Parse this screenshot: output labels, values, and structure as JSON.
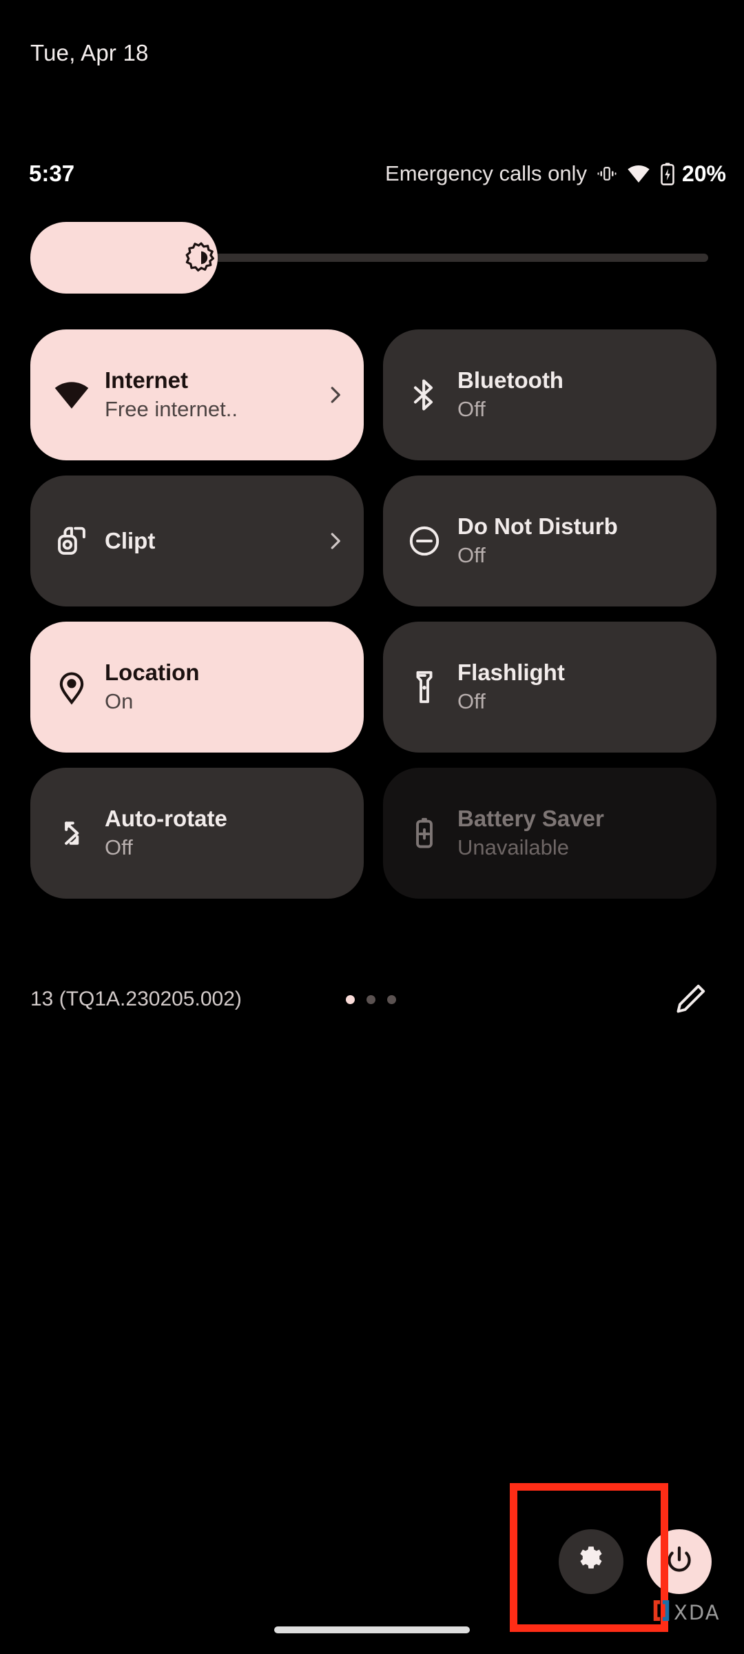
{
  "header": {
    "date": "Tue, Apr 18"
  },
  "status_bar": {
    "clock": "5:37",
    "carrier": "Emergency calls only",
    "battery_percent": "20%",
    "icons": [
      "vibrate-icon",
      "wifi-icon",
      "battery-charging-icon"
    ]
  },
  "brightness": {
    "name": "brightness-slider",
    "icon": "brightness-icon",
    "level_percent": 27
  },
  "tiles": [
    {
      "label": "Internet",
      "sub": "Free internet..",
      "state": "active",
      "icon": "wifi-icon",
      "chevron": true
    },
    {
      "label": "Bluetooth",
      "sub": "Off",
      "state": "inactive",
      "icon": "bluetooth-icon",
      "chevron": false
    },
    {
      "label": "Clipt",
      "sub": "",
      "state": "inactive",
      "icon": "clipt-icon",
      "chevron": true
    },
    {
      "label": "Do Not Disturb",
      "sub": "Off",
      "state": "inactive",
      "icon": "do-not-disturb-icon",
      "chevron": false
    },
    {
      "label": "Location",
      "sub": "On",
      "state": "active",
      "icon": "location-pin-icon",
      "chevron": false
    },
    {
      "label": "Flashlight",
      "sub": "Off",
      "state": "inactive",
      "icon": "flashlight-icon",
      "chevron": false
    },
    {
      "label": "Auto-rotate",
      "sub": "Off",
      "state": "inactive",
      "icon": "auto-rotate-icon",
      "chevron": false
    },
    {
      "label": "Battery Saver",
      "sub": "Unavailable",
      "state": "disabled",
      "icon": "battery-saver-icon",
      "chevron": false
    }
  ],
  "footer": {
    "build": "13 (TQ1A.230205.002)",
    "page_dots": {
      "count": 3,
      "active_index": 0
    },
    "edit_icon": "pencil-edit-icon"
  },
  "bottom_actions": {
    "settings_icon": "gear-icon",
    "power_icon": "power-icon"
  },
  "annotation": {
    "type": "highlight-rectangle",
    "color": "#FF2D16",
    "target": "settings-button"
  },
  "watermark": {
    "text": "XDA"
  },
  "colors": {
    "background": "#000000",
    "tile_active": "#FADCD9",
    "tile_inactive": "#332F2E",
    "tile_disabled": "#141212",
    "accent_pink": "#FADCD9",
    "annotation_red": "#FF2D16"
  }
}
